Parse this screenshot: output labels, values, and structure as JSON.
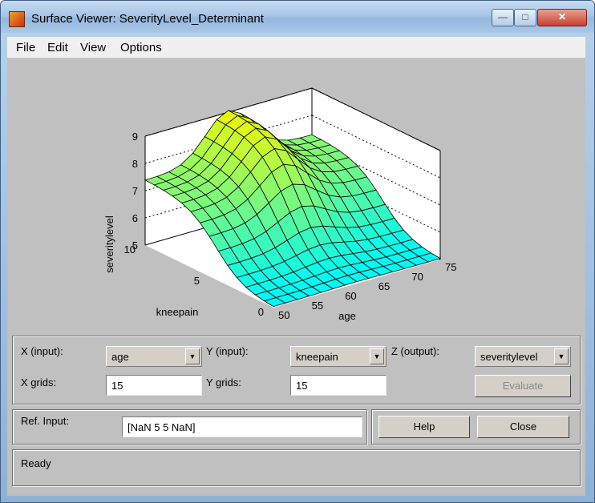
{
  "window": {
    "title": "Surface Viewer: SeverityLevel_Determinant"
  },
  "caption_buttons": {
    "minimize": "—",
    "maximize": "□",
    "close": "✕"
  },
  "menu": {
    "items": [
      "File",
      "Edit",
      "View",
      "Options"
    ]
  },
  "plot": {
    "zlabel": "severitylevel",
    "ylabel": "kneepain",
    "xlabel": "age",
    "z_ticks": [
      "5",
      "6",
      "7",
      "8",
      "9"
    ],
    "y_ticks": [
      "0",
      "5",
      "10"
    ],
    "x_ticks": [
      "50",
      "55",
      "60",
      "65",
      "70",
      "75"
    ],
    "colors": {
      "low": "#00f8f8",
      "high": "#f8f800"
    }
  },
  "chart_data": {
    "type": "surface",
    "x_name": "age",
    "y_name": "kneepain",
    "z_name": "severitylevel",
    "xlim": [
      50,
      75
    ],
    "ylim": [
      0,
      10
    ],
    "zlim": [
      5,
      9
    ],
    "grid": true,
    "corners": {
      "x50_y10": 7.5,
      "x50_y0": 5.0,
      "x75_y0": 5.0,
      "x75_y10": 7.6,
      "x62_y10": 9.3
    }
  },
  "controls": {
    "x_input_label": "X (input):",
    "x_input_value": "age",
    "y_input_label": "Y (input):",
    "y_input_value": "kneepain",
    "z_output_label": "Z (output):",
    "z_output_value": "severitylevel",
    "x_grids_label": "X grids:",
    "x_grids_value": "15",
    "y_grids_label": "Y grids:",
    "y_grids_value": "15",
    "evaluate_label": "Evaluate"
  },
  "ref": {
    "label": "Ref. Input:",
    "value": "[NaN 5 5 NaN]"
  },
  "buttons": {
    "help": "Help",
    "close": "Close"
  },
  "status": {
    "text": "Ready"
  }
}
